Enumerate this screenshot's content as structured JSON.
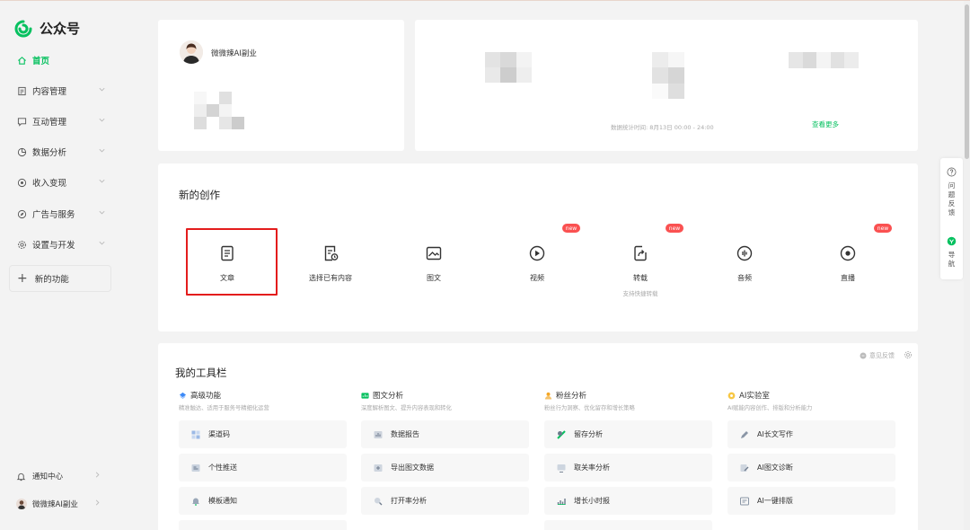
{
  "app": {
    "title": "公众号"
  },
  "sidebar": {
    "items": [
      {
        "label": "首页",
        "icon": "home-icon",
        "active": true
      },
      {
        "label": "内容管理",
        "icon": "document-icon"
      },
      {
        "label": "互动管理",
        "icon": "chat-icon"
      },
      {
        "label": "数据分析",
        "icon": "chart-icon"
      },
      {
        "label": "收入变现",
        "icon": "coin-icon"
      },
      {
        "label": "广告与服务",
        "icon": "compass-icon"
      },
      {
        "label": "设置与开发",
        "icon": "gear-icon"
      }
    ],
    "new_features": "新的功能",
    "notifications": "通知中心",
    "account": "微微辣AI副业"
  },
  "profile": {
    "name": "微微辣AI副业"
  },
  "stats": {
    "footnote": "数据统计时间: 8月13日 00:00 - 24:00",
    "more_link": "查看更多"
  },
  "create": {
    "title": "新的创作",
    "badge": "new",
    "items": [
      {
        "label": "文章",
        "icon": "article-icon"
      },
      {
        "label": "选择已有内容",
        "icon": "existing-content-icon"
      },
      {
        "label": "图文",
        "icon": "image-text-icon"
      },
      {
        "label": "视频",
        "icon": "video-icon",
        "new": true
      },
      {
        "label": "转载",
        "icon": "repost-icon",
        "new": true,
        "sub": "支持快捷转载"
      },
      {
        "label": "音频",
        "icon": "audio-icon"
      },
      {
        "label": "直播",
        "icon": "live-icon",
        "new": true
      }
    ]
  },
  "toolbar": {
    "title": "我的工具栏",
    "feedback": "意见反馈",
    "columns": [
      {
        "title": "高级功能",
        "desc": "精准触达、适用于服务号精细化运营",
        "color": "#3d8af7",
        "tools": [
          "渠道码",
          "个性推送",
          "模板通知"
        ]
      },
      {
        "title": "图文分析",
        "desc": "深度解析图文、提升内容表现和转化",
        "color": "#07c160",
        "tools": [
          "数据报告",
          "导出图文数据",
          "打开率分析"
        ]
      },
      {
        "title": "粉丝分析",
        "desc": "粉丝行为洞察、优化留存和增长策略",
        "color": "#f5a623",
        "tools": [
          "留存分析",
          "取关率分析",
          "增长小时报"
        ]
      },
      {
        "title": "AI实验室",
        "desc": "AI赋能内容创作、排版和分析能力",
        "color": "#f7c744",
        "tools": [
          "AI长文写作",
          "AI图文诊断",
          "AI一键排版"
        ]
      }
    ]
  },
  "float_panel": {
    "feedback": "问题反馈",
    "nav": "导航"
  },
  "colors": {
    "brand": "#07c160",
    "alert": "#fa5151",
    "highlight": "#e31c1c"
  }
}
